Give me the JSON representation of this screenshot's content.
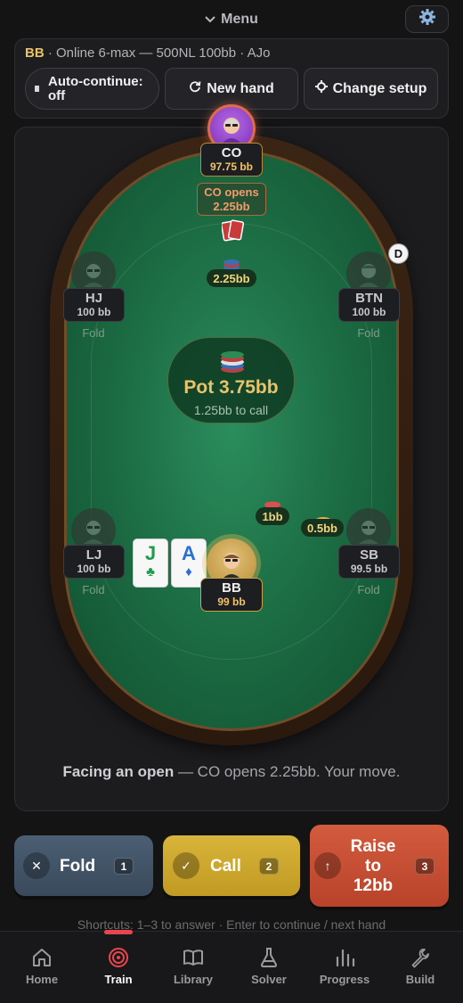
{
  "topbar": {
    "menu_label": "Menu",
    "settings_icon": "gear-icon"
  },
  "info": {
    "position": "BB",
    "description": " · Online 6-max — 500NL 100bb · AJo"
  },
  "controls": {
    "auto_continue_line1": "Auto-continue:",
    "auto_continue_line2": "off",
    "new_hand": "New hand",
    "change_setup": "Change setup"
  },
  "seats": {
    "co": {
      "name": "CO",
      "stack": "97.75 bb",
      "action_line1": "CO opens",
      "action_line2": "2.25bb",
      "bet": "2.25bb"
    },
    "hj": {
      "name": "HJ",
      "stack": "100 bb",
      "status": "Fold"
    },
    "btn": {
      "name": "BTN",
      "stack": "100 bb",
      "status": "Fold",
      "dealer": "D"
    },
    "lj": {
      "name": "LJ",
      "stack": "100 bb",
      "status": "Fold"
    },
    "sb": {
      "name": "SB",
      "stack": "99.5 bb",
      "status": "Fold",
      "bet": "0.5bb"
    },
    "bb": {
      "name": "BB",
      "stack": "99 bb",
      "bet": "1bb"
    }
  },
  "hero_cards": [
    {
      "rank": "J",
      "suit": "♣",
      "color": "#1e9b4c"
    },
    {
      "rank": "A",
      "suit": "♦",
      "color": "#2a6fd6"
    }
  ],
  "pot": {
    "amount": "Pot 3.75bb",
    "to_call": "1.25bb to call"
  },
  "prompt": {
    "bold": "Facing an open",
    "rest": " — CO opens 2.25bb. Your move."
  },
  "actions": {
    "fold": {
      "label": "Fold",
      "key": "1"
    },
    "call": {
      "label": "Call",
      "key": "2"
    },
    "raise": {
      "line1": "Raise",
      "line2": "to",
      "line3": "12bb",
      "key": "3"
    }
  },
  "shortcuts": "Shortcuts: 1–3 to answer · Enter to continue / next hand",
  "nav": {
    "active": "Train",
    "items": [
      "Home",
      "Train",
      "Library",
      "Solver",
      "Progress",
      "Build"
    ]
  },
  "colors": {
    "accent_red": "#e8454e",
    "gold": "#e9c26a",
    "felt": "#1d6e45",
    "raise": "#c94e34",
    "call": "#cfa72c",
    "fold": "#43556a"
  }
}
